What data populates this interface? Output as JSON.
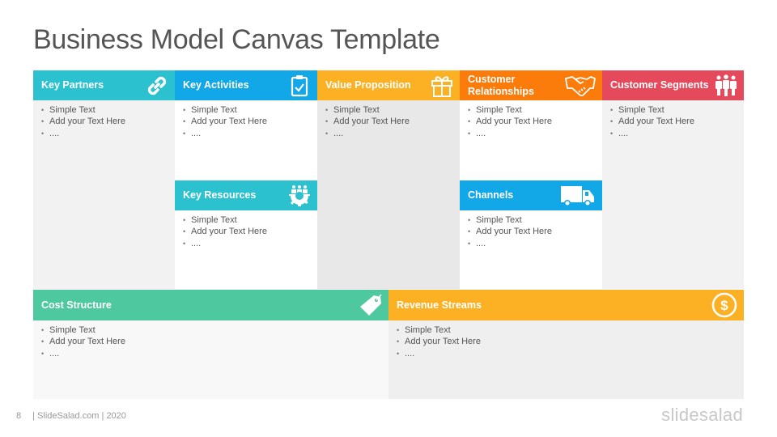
{
  "title": "Business Model Canvas Template",
  "bullets": [
    "Simple Text",
    "Add your Text Here",
    "...."
  ],
  "blocks": {
    "key_partners": {
      "label": "Key Partners",
      "icon": "link-icon",
      "color": "#2bc1cf",
      "body_bg": "#f2f2f2"
    },
    "key_activities": {
      "label": "Key Activities",
      "icon": "clipboard-check-icon",
      "color": "#12a7e6",
      "body_bg": "#ffffff"
    },
    "value_proposition": {
      "label": "Value Proposition",
      "icon": "gift-icon",
      "color": "#fbb123",
      "body_bg": "#e8e8e8"
    },
    "customer_relationships": {
      "label": "Customer Relationships",
      "icon": "handshake-icon",
      "color": "#fb7b0b",
      "body_bg": "#ffffff"
    },
    "customer_segments": {
      "label": "Customer Segments",
      "icon": "people-group-icon",
      "color": "#e44a5c",
      "body_bg": "#f2f2f2"
    },
    "key_resources": {
      "label": "Key Resources",
      "icon": "team-gear-icon",
      "color": "#2bc1cf",
      "body_bg": "#ffffff"
    },
    "channels": {
      "label": "Channels",
      "icon": "delivery-truck-icon",
      "color": "#12a7e6",
      "body_bg": "#ffffff"
    },
    "cost_structure": {
      "label": "Cost Structure",
      "icon": "price-tag-icon",
      "color": "#4ec89f",
      "body_bg": "#f8f8f8"
    },
    "revenue_streams": {
      "label": "Revenue Streams",
      "icon": "dollar-circle-icon",
      "color": "#fbb123",
      "body_bg": "#efefef"
    }
  },
  "footer": {
    "page_number": "8",
    "credit": "| SlideSalad.com | 2020",
    "logo": "slidesalad"
  }
}
